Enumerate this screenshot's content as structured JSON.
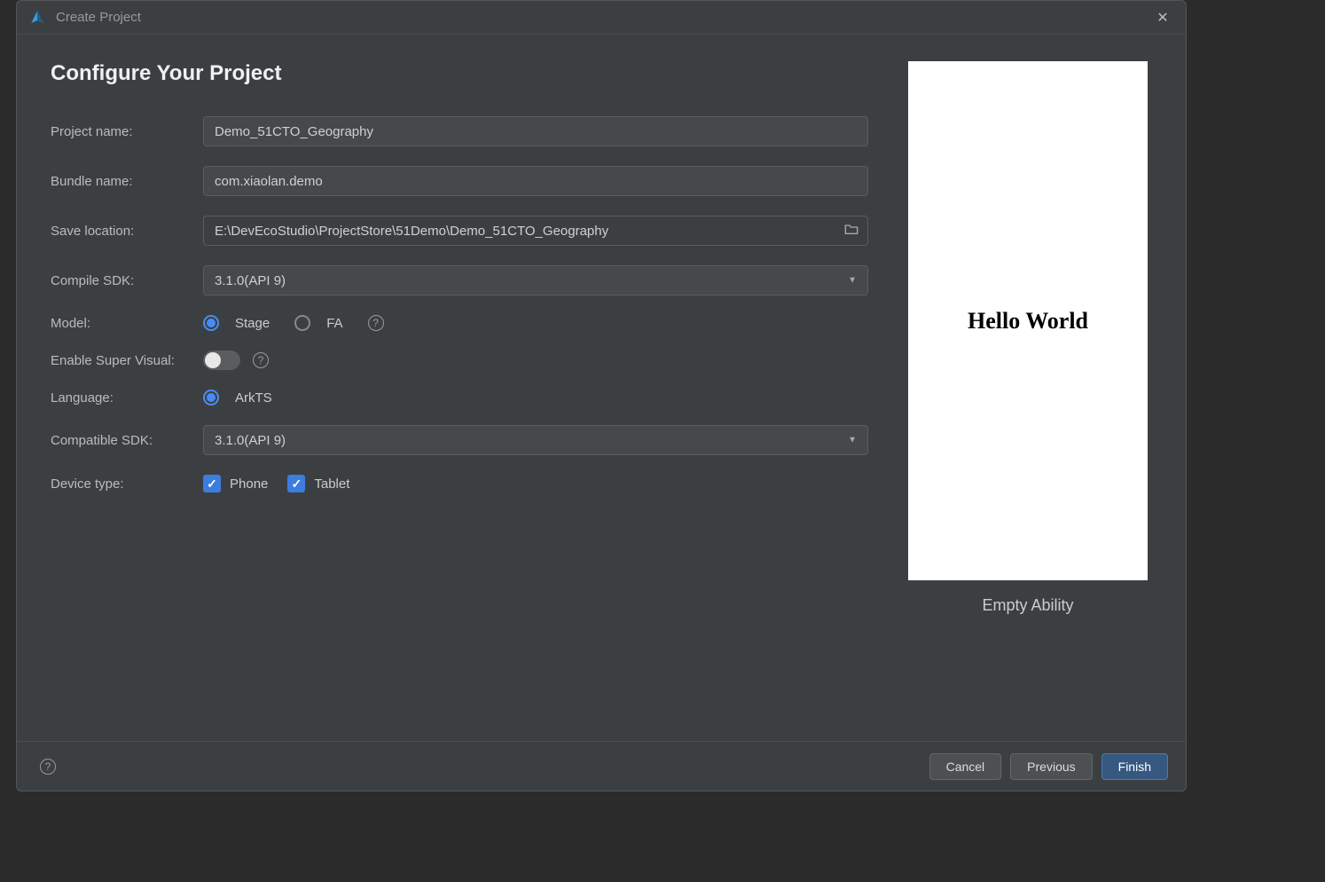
{
  "titlebar": {
    "title": "Create Project"
  },
  "heading": "Configure Your Project",
  "labels": {
    "project_name": "Project name:",
    "bundle_name": "Bundle name:",
    "save_location": "Save location:",
    "compile_sdk": "Compile SDK:",
    "model": "Model:",
    "enable_super_visual": "Enable Super Visual:",
    "language": "Language:",
    "compatible_sdk": "Compatible SDK:",
    "device_type": "Device type:"
  },
  "values": {
    "project_name": "Demo_51CTO_Geography",
    "bundle_name": "com.xiaolan.demo",
    "save_location": "E:\\DevEcoStudio\\ProjectStore\\51Demo\\Demo_51CTO_Geography",
    "compile_sdk": "3.1.0(API 9)",
    "compatible_sdk": "3.1.0(API 9)"
  },
  "model": {
    "options": {
      "stage": "Stage",
      "fa": "FA"
    },
    "selected": "stage"
  },
  "enable_super_visual": false,
  "language": {
    "options": {
      "arkts": "ArkTS"
    },
    "selected": "arkts"
  },
  "device_type": {
    "phone": {
      "label": "Phone",
      "checked": true
    },
    "tablet": {
      "label": "Tablet",
      "checked": true
    }
  },
  "preview": {
    "text": "Hello World",
    "caption": "Empty Ability"
  },
  "footer": {
    "cancel": "Cancel",
    "previous": "Previous",
    "finish": "Finish"
  }
}
